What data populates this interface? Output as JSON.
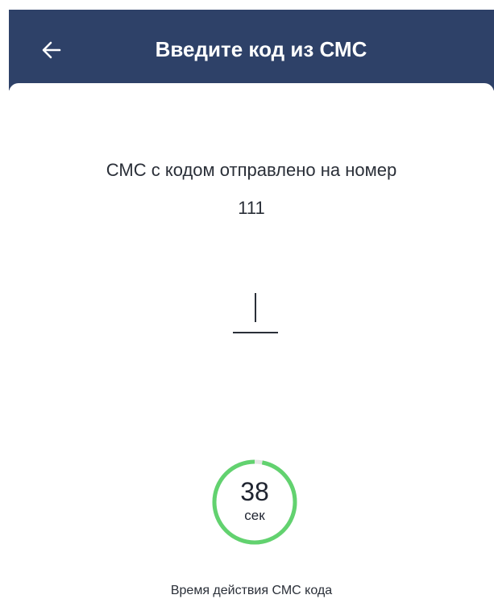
{
  "header": {
    "title": "Введите код из СМС",
    "back_icon": "arrow-left-icon",
    "background": "#2e4168"
  },
  "content": {
    "sent_message": "СМС с кодом отправлено на номер",
    "phone_number": "111",
    "code_value": ""
  },
  "timer": {
    "value": "38",
    "unit": "сек",
    "progress_remaining": 0.97,
    "ring_color": "#62d26f",
    "track_color": "#e6e6e6"
  },
  "footer": {
    "validity_label": "Время действия СМС кода"
  }
}
